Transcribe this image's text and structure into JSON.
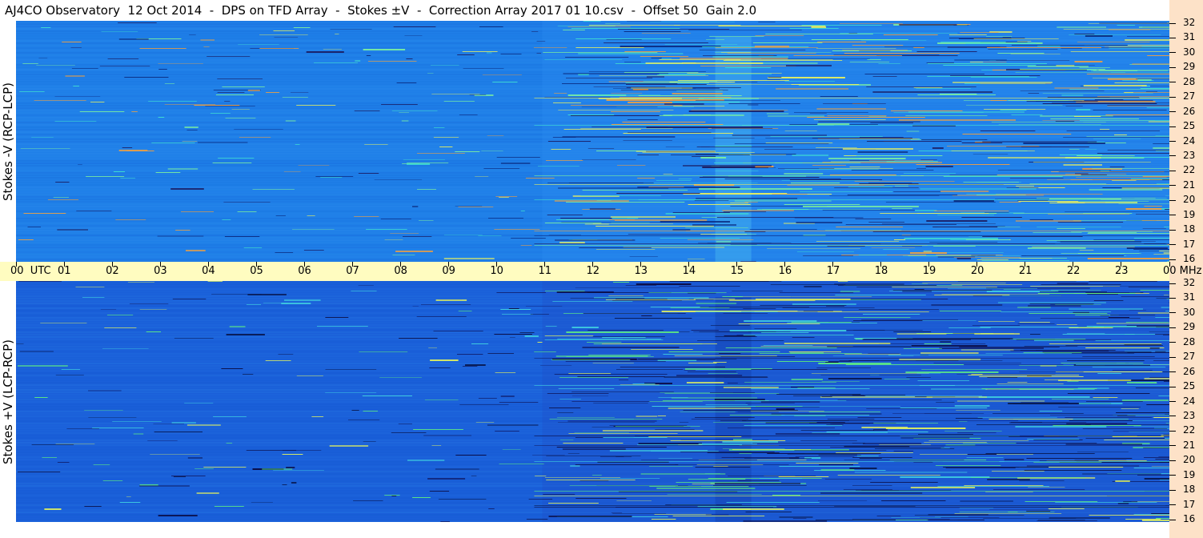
{
  "title": "AJ4CO Observatory  12 Oct 2014  -  DPS on TFD Array  -  Stokes ±V  -  Correction Array 2017 01 10.csv  -  Offset 50  Gain 2.0",
  "colors": {
    "background_upper": "#1f7fe8",
    "background_lower": "#1a5fd9",
    "time_bar": "#fffcc0",
    "right_strip": "#fde2c8"
  },
  "chart_data": [
    {
      "type": "heatmap",
      "ylabel": "Stokes -V (RCP-LCP)",
      "x_ticks": [
        "00",
        "01",
        "02",
        "03",
        "04",
        "05",
        "06",
        "07",
        "08",
        "09",
        "10",
        "11",
        "12",
        "13",
        "14",
        "15",
        "16",
        "17",
        "18",
        "19",
        "20",
        "21",
        "22",
        "23",
        "00"
      ],
      "x_unit": "UTC",
      "xlim": [
        0,
        24
      ],
      "y_ticks": [
        "32",
        "31",
        "30",
        "29",
        "28",
        "27",
        "26",
        "25",
        "24",
        "23",
        "22",
        "21",
        "20",
        "19",
        "18",
        "17",
        "16"
      ],
      "y_unit": "MHz",
      "ylim": [
        16,
        32
      ]
    },
    {
      "type": "heatmap",
      "ylabel": "Stokes +V (LCP-RCP)",
      "x_ticks": [
        "00",
        "01",
        "02",
        "03",
        "04",
        "05",
        "06",
        "07",
        "08",
        "09",
        "10",
        "11",
        "12",
        "13",
        "14",
        "15",
        "16",
        "17",
        "18",
        "19",
        "20",
        "21",
        "22",
        "23",
        "00"
      ],
      "x_unit": "UTC",
      "xlim": [
        0,
        24
      ],
      "y_ticks": [
        "32",
        "31",
        "30",
        "29",
        "28",
        "27",
        "26",
        "25",
        "24",
        "23",
        "22",
        "21",
        "20",
        "19",
        "18",
        "17",
        "16"
      ],
      "y_unit": "MHz",
      "ylim": [
        16,
        32
      ]
    }
  ]
}
